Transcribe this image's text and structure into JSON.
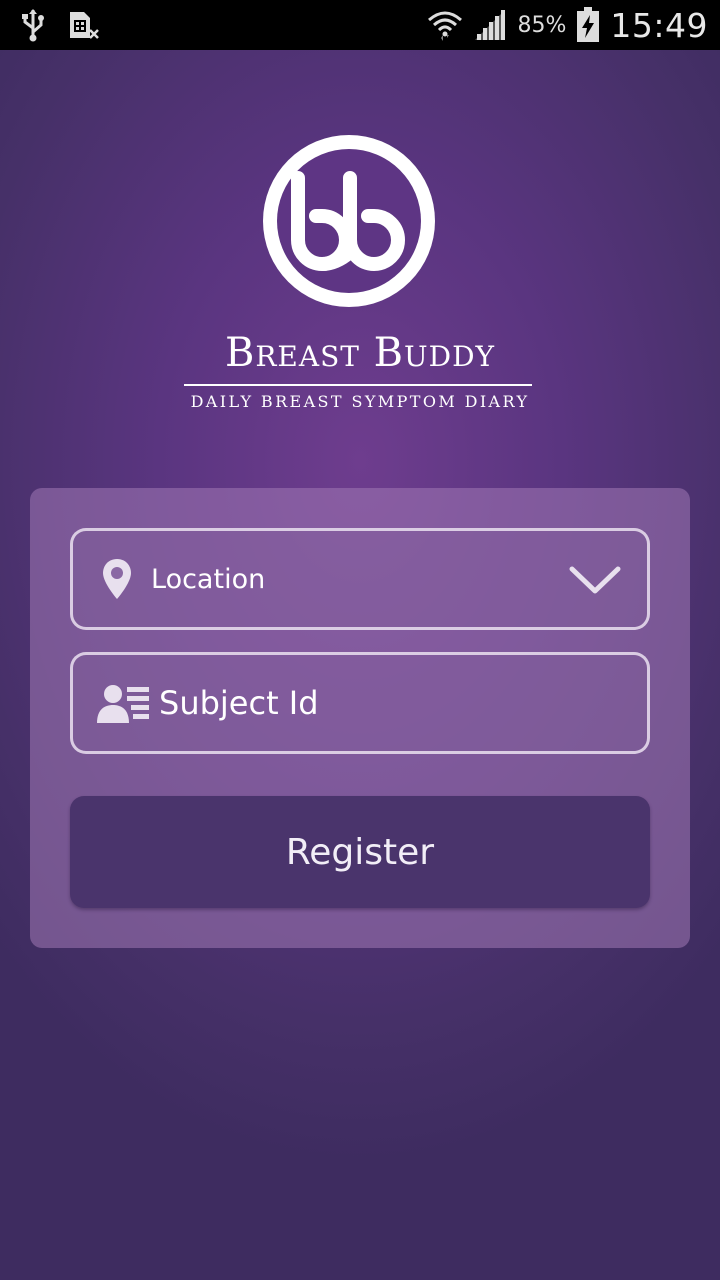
{
  "status_bar": {
    "battery_percent": "85%",
    "time": "15:49",
    "icons": [
      "usb-icon",
      "sim-card-icon",
      "wifi-icon",
      "signal-icon",
      "battery-charging-icon"
    ]
  },
  "brand": {
    "logo_icon": "bb-logo-icon",
    "name": "Breast Buddy",
    "tagline": "DAILY BREAST SYMPTOM DIARY"
  },
  "form": {
    "location": {
      "value": "Location",
      "icon": "location-pin-icon",
      "dropdown_icon": "chevron-down-icon"
    },
    "subject_id": {
      "placeholder": "Subject Id",
      "icon": "person-card-icon"
    },
    "register_label": "Register"
  },
  "colors": {
    "background": "#5a3580",
    "card": "#8a6aa0",
    "button": "#4a346c",
    "text": "#ffffff"
  }
}
